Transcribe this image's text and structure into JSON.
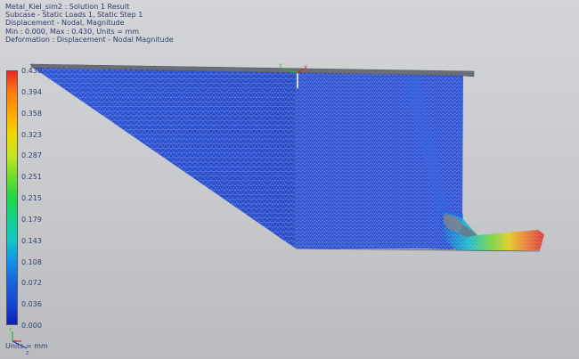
{
  "header": {
    "line1": "Metal_Kiel_sim2 : Solution 1 Result",
    "line2": "Subcase - Static Loads 1, Static Step 1",
    "line3": "Displacement - Nodal, Magnitude",
    "line4": "Min : 0.000, Max : 0.430, Units = mm",
    "line5": "Deformation : Displacement - Nodal Magnitude"
  },
  "legend": {
    "ticks": [
      "0.430",
      "0.394",
      "0.358",
      "0.323",
      "0.287",
      "0.251",
      "0.215",
      "0.179",
      "0.143",
      "0.108",
      "0.072",
      "0.036",
      "0.000"
    ],
    "colors": [
      "#e8281c",
      "#ff7a10",
      "#ffa800",
      "#f0d800",
      "#c4e61a",
      "#6ede2a",
      "#1ed646",
      "#10d28c",
      "#10c8c8",
      "#1092e8",
      "#1464e0",
      "#1448d4",
      "#1020b8"
    ]
  },
  "footer": {
    "units": "Units = mm"
  },
  "colors": {
    "mesh_blue": "#2a4fd0",
    "mesh_line": "#8ea6e6",
    "top_plate": "#6b6e78"
  }
}
